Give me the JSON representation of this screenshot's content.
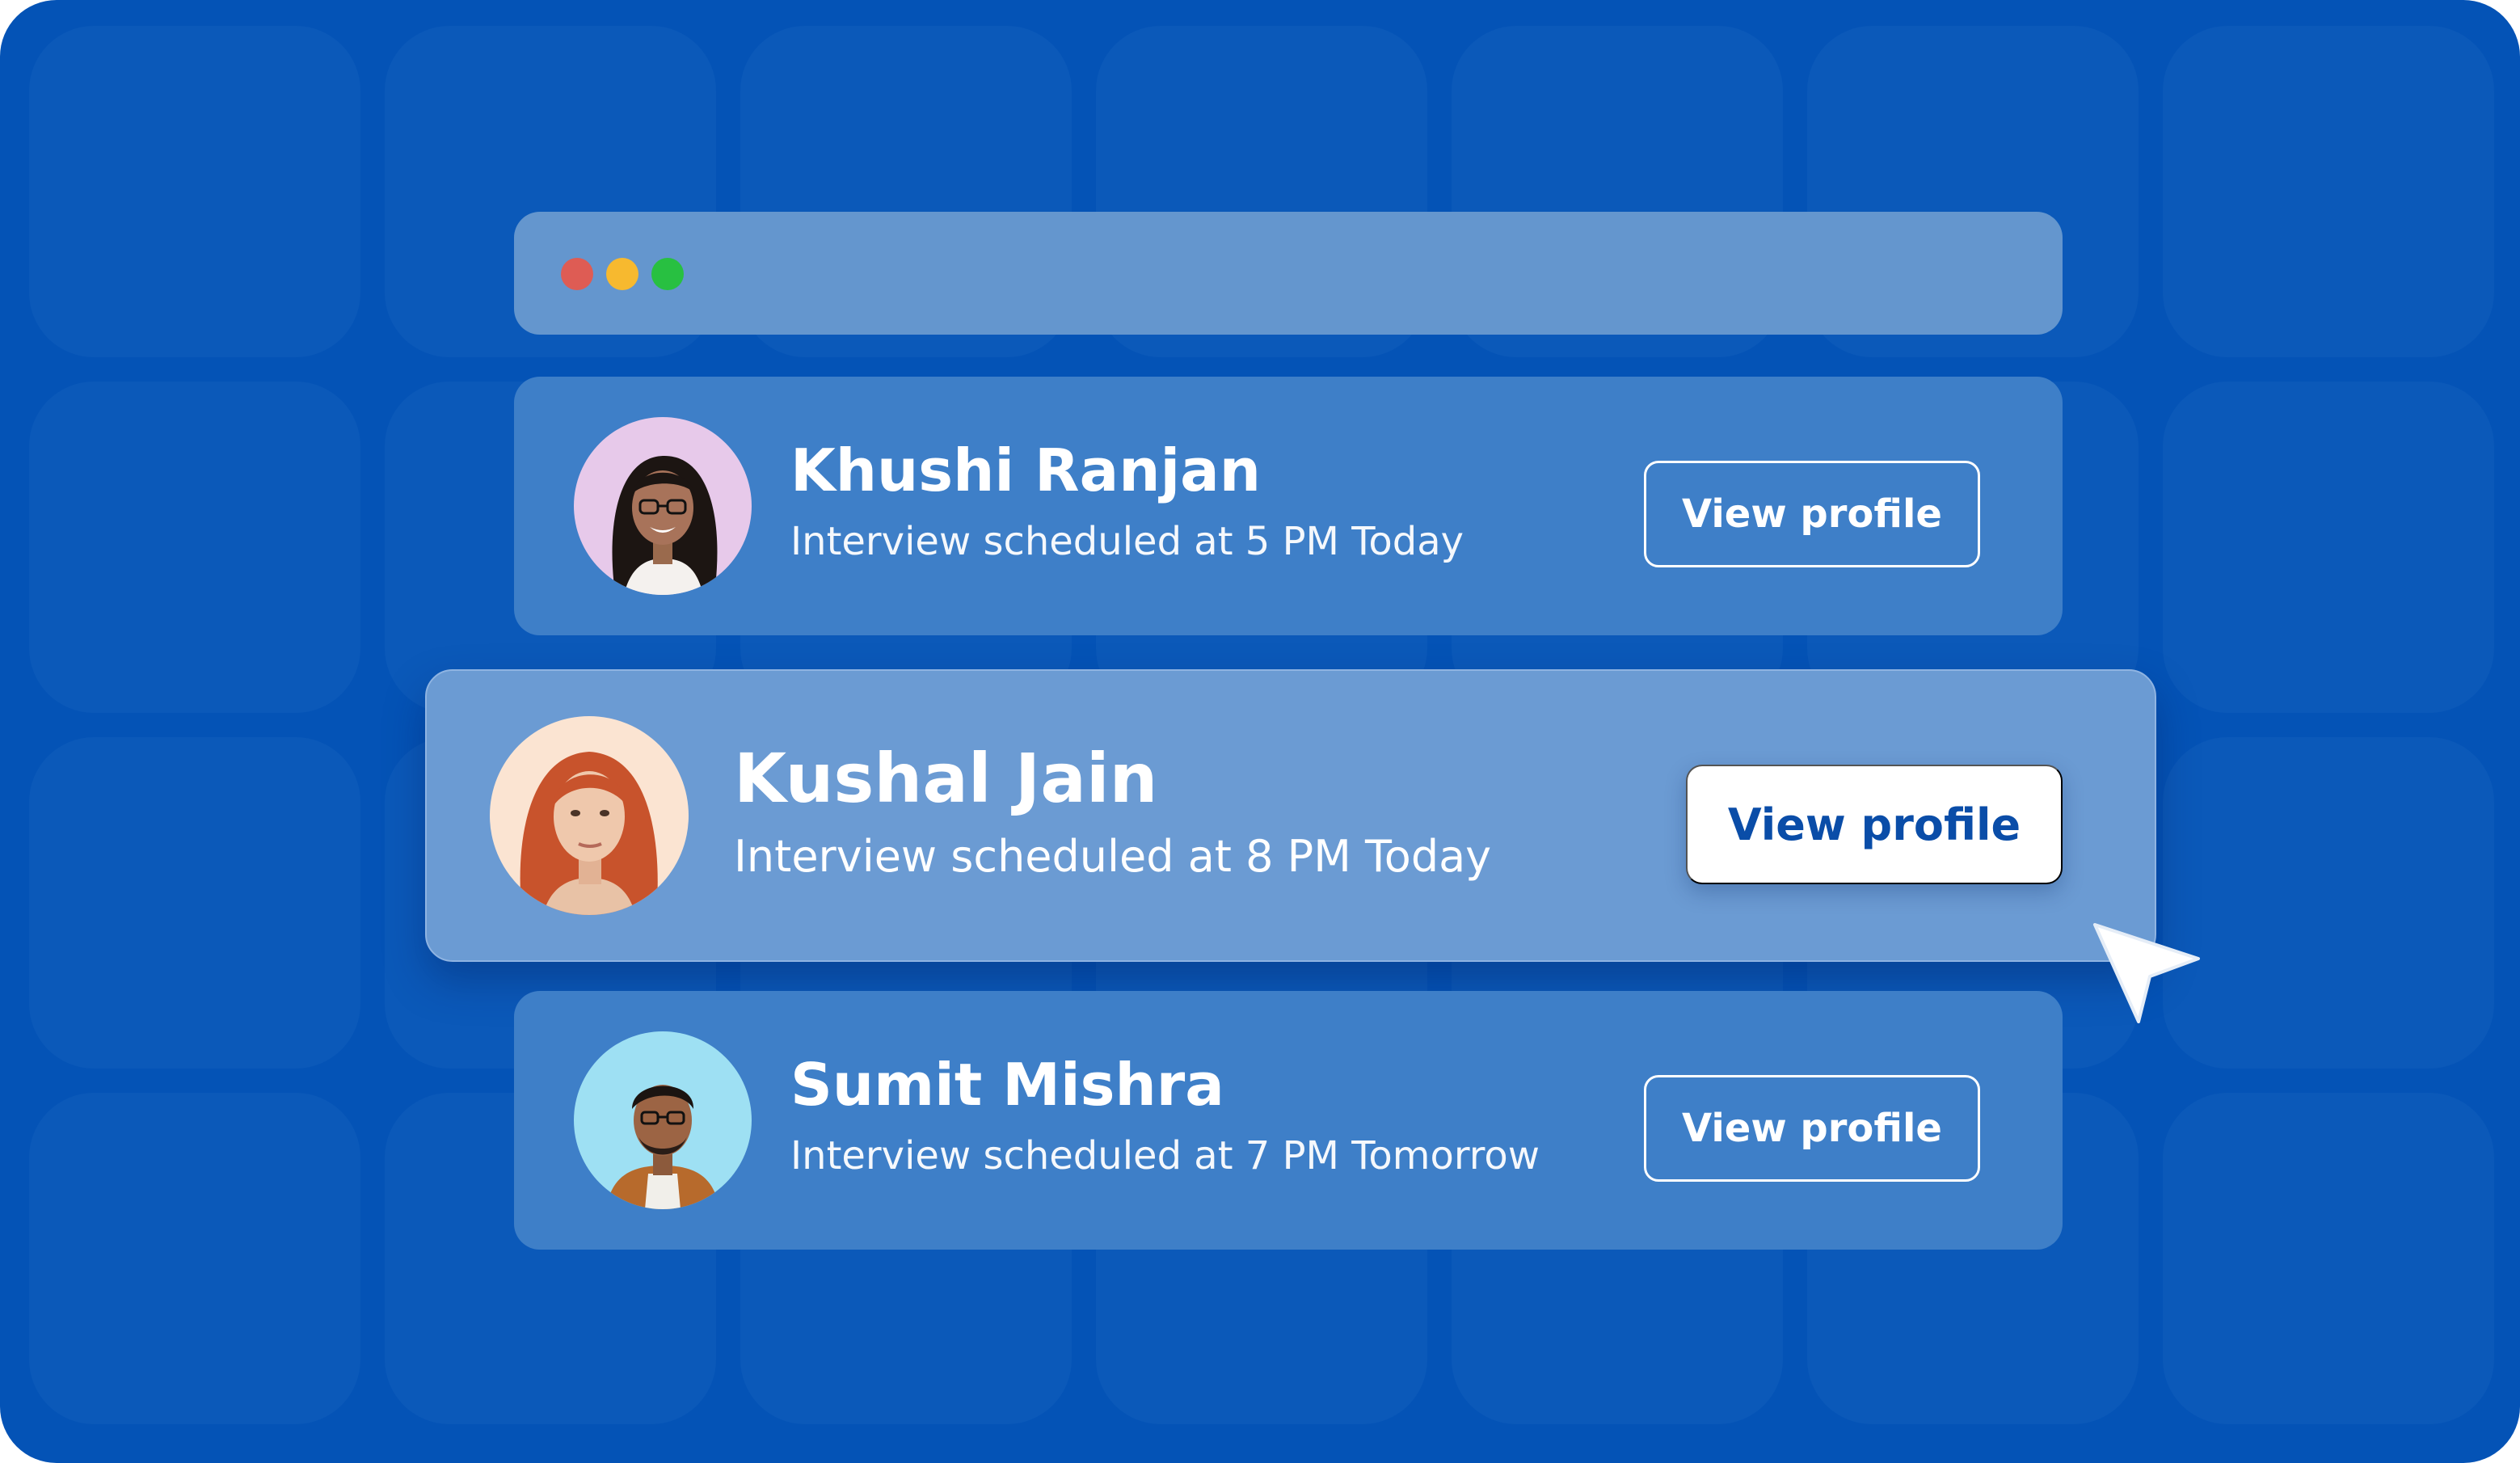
{
  "window": {
    "controls": [
      "close-dot",
      "minimize-dot",
      "maximize-dot"
    ],
    "control_colors": [
      "#de5c54",
      "#f7b92f",
      "#28c041"
    ]
  },
  "candidates": [
    {
      "name": "Khushi Ranjan",
      "schedule": "Interview scheduled at 5 PM Today",
      "button_label": "View profile",
      "avatar_background": "#e7c9ea",
      "highlighted": false
    },
    {
      "name": "Kushal Jain",
      "schedule": "Interview scheduled at 8 PM Today",
      "button_label": "View profile",
      "avatar_background": "#fbe4d2",
      "highlighted": true
    },
    {
      "name": "Sumit Mishra",
      "schedule": "Interview scheduled at 7 PM Tomorrow",
      "button_label": "View profile",
      "avatar_background": "#9ee0f3",
      "highlighted": false
    }
  ],
  "colors": {
    "background": "#0453b6",
    "card": "#3e7fc8",
    "highlighted_card": "#6b9bd3",
    "button_text_primary": "#0a4da8"
  },
  "cursor": "arrow-cursor-icon"
}
